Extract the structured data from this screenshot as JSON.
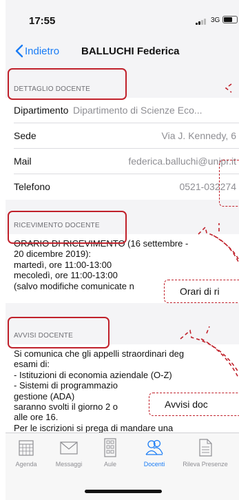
{
  "status": {
    "time": "17:55",
    "network": "3G"
  },
  "nav": {
    "back_label": "Indietro",
    "title": "BALLUCHI Federica"
  },
  "dettaglio": {
    "header": "DETTAGLIO DOCENTE",
    "rows": [
      {
        "label": "Dipartimento",
        "value": "Dipartimento di Scienze Eco..."
      },
      {
        "label": "Sede",
        "value": "Via J. Kennedy, 6"
      },
      {
        "label": "Mail",
        "value": "federica.balluchi@unipr.it"
      },
      {
        "label": "Telefono",
        "value": "0521-032274"
      }
    ]
  },
  "ricevimento": {
    "header": "RICEVIMENTO DOCENTE",
    "lines": [
      "ORARIO DI RICEVIMENTO (16 settembre -",
      "20 dicembre 2019):",
      "martedì, ore 11:00-13:00",
      "mecoledì, ore 11:00-13:00",
      "(salvo modifiche comunicate n"
    ]
  },
  "avvisi": {
    "header": "AVVISI DOCENTE",
    "lines": [
      "Si comunica che gli appelli straordinari deg",
      "esami di:",
      "- Istituzioni di economia aziendale (O-Z)",
      "- Sistemi di programmazio",
      "gestione (ADA)",
      "saranno svolti il giorno 2 o",
      "alle ore 16.",
      "Per le iscrizioni si prega di mandare una"
    ]
  },
  "callouts": {
    "orari": "Orari di ri",
    "avvisi": "Avvisi doc"
  },
  "tabs": [
    {
      "label": "Agenda",
      "icon": "calendar-icon"
    },
    {
      "label": "Messaggi",
      "icon": "envelope-icon"
    },
    {
      "label": "Aule",
      "icon": "building-icon"
    },
    {
      "label": "Docenti",
      "icon": "people-icon",
      "active": true
    },
    {
      "label": "Rileva Presenze",
      "icon": "document-icon"
    }
  ],
  "colors": {
    "accent": "#1a7cf5",
    "annotation": "#c0202a"
  }
}
